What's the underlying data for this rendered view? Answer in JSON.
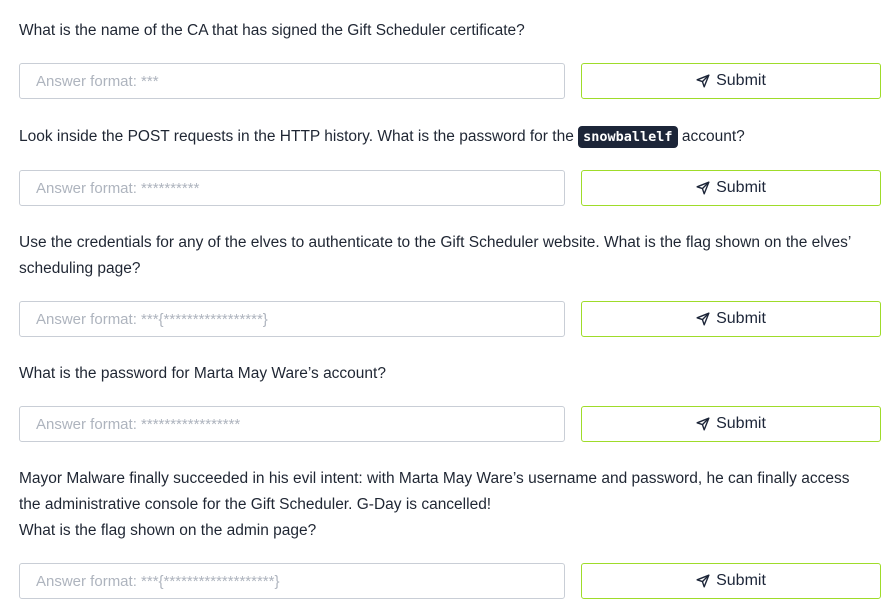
{
  "questions": [
    {
      "text": "What is the name of the CA that has signed the Gift Scheduler certificate?",
      "placeholder": "Answer format: ***",
      "submit_label": "Submit"
    },
    {
      "text_before": "Look inside the POST requests in the HTTP history. What is the password for the",
      "code": "snowballelf",
      "text_after": "account?",
      "placeholder": "Answer format: **********",
      "submit_label": "Submit"
    },
    {
      "text": "Use the credentials for any of the elves to authenticate to the Gift Scheduler website. What is the flag shown on the elves’ scheduling page?",
      "placeholder": "Answer format: ***{*****************}",
      "submit_label": "Submit"
    },
    {
      "text": "What is the password for Marta May Ware’s account?",
      "placeholder": "Answer format: *****************",
      "submit_label": "Submit"
    },
    {
      "text_line1": "Mayor Malware finally succeeded in his evil intent: with Marta May Ware’s username and password, he can finally access the administrative console for the Gift Scheduler. G-Day is cancelled!",
      "text_line2": "What is the flag shown on the admin page?",
      "placeholder": "Answer format: ***{*******************}",
      "submit_label": "Submit"
    }
  ],
  "icons": {
    "submit": "paper-plane-icon"
  },
  "colors": {
    "accent_border": "#9fdc2a",
    "code_bg": "#1c2538"
  }
}
